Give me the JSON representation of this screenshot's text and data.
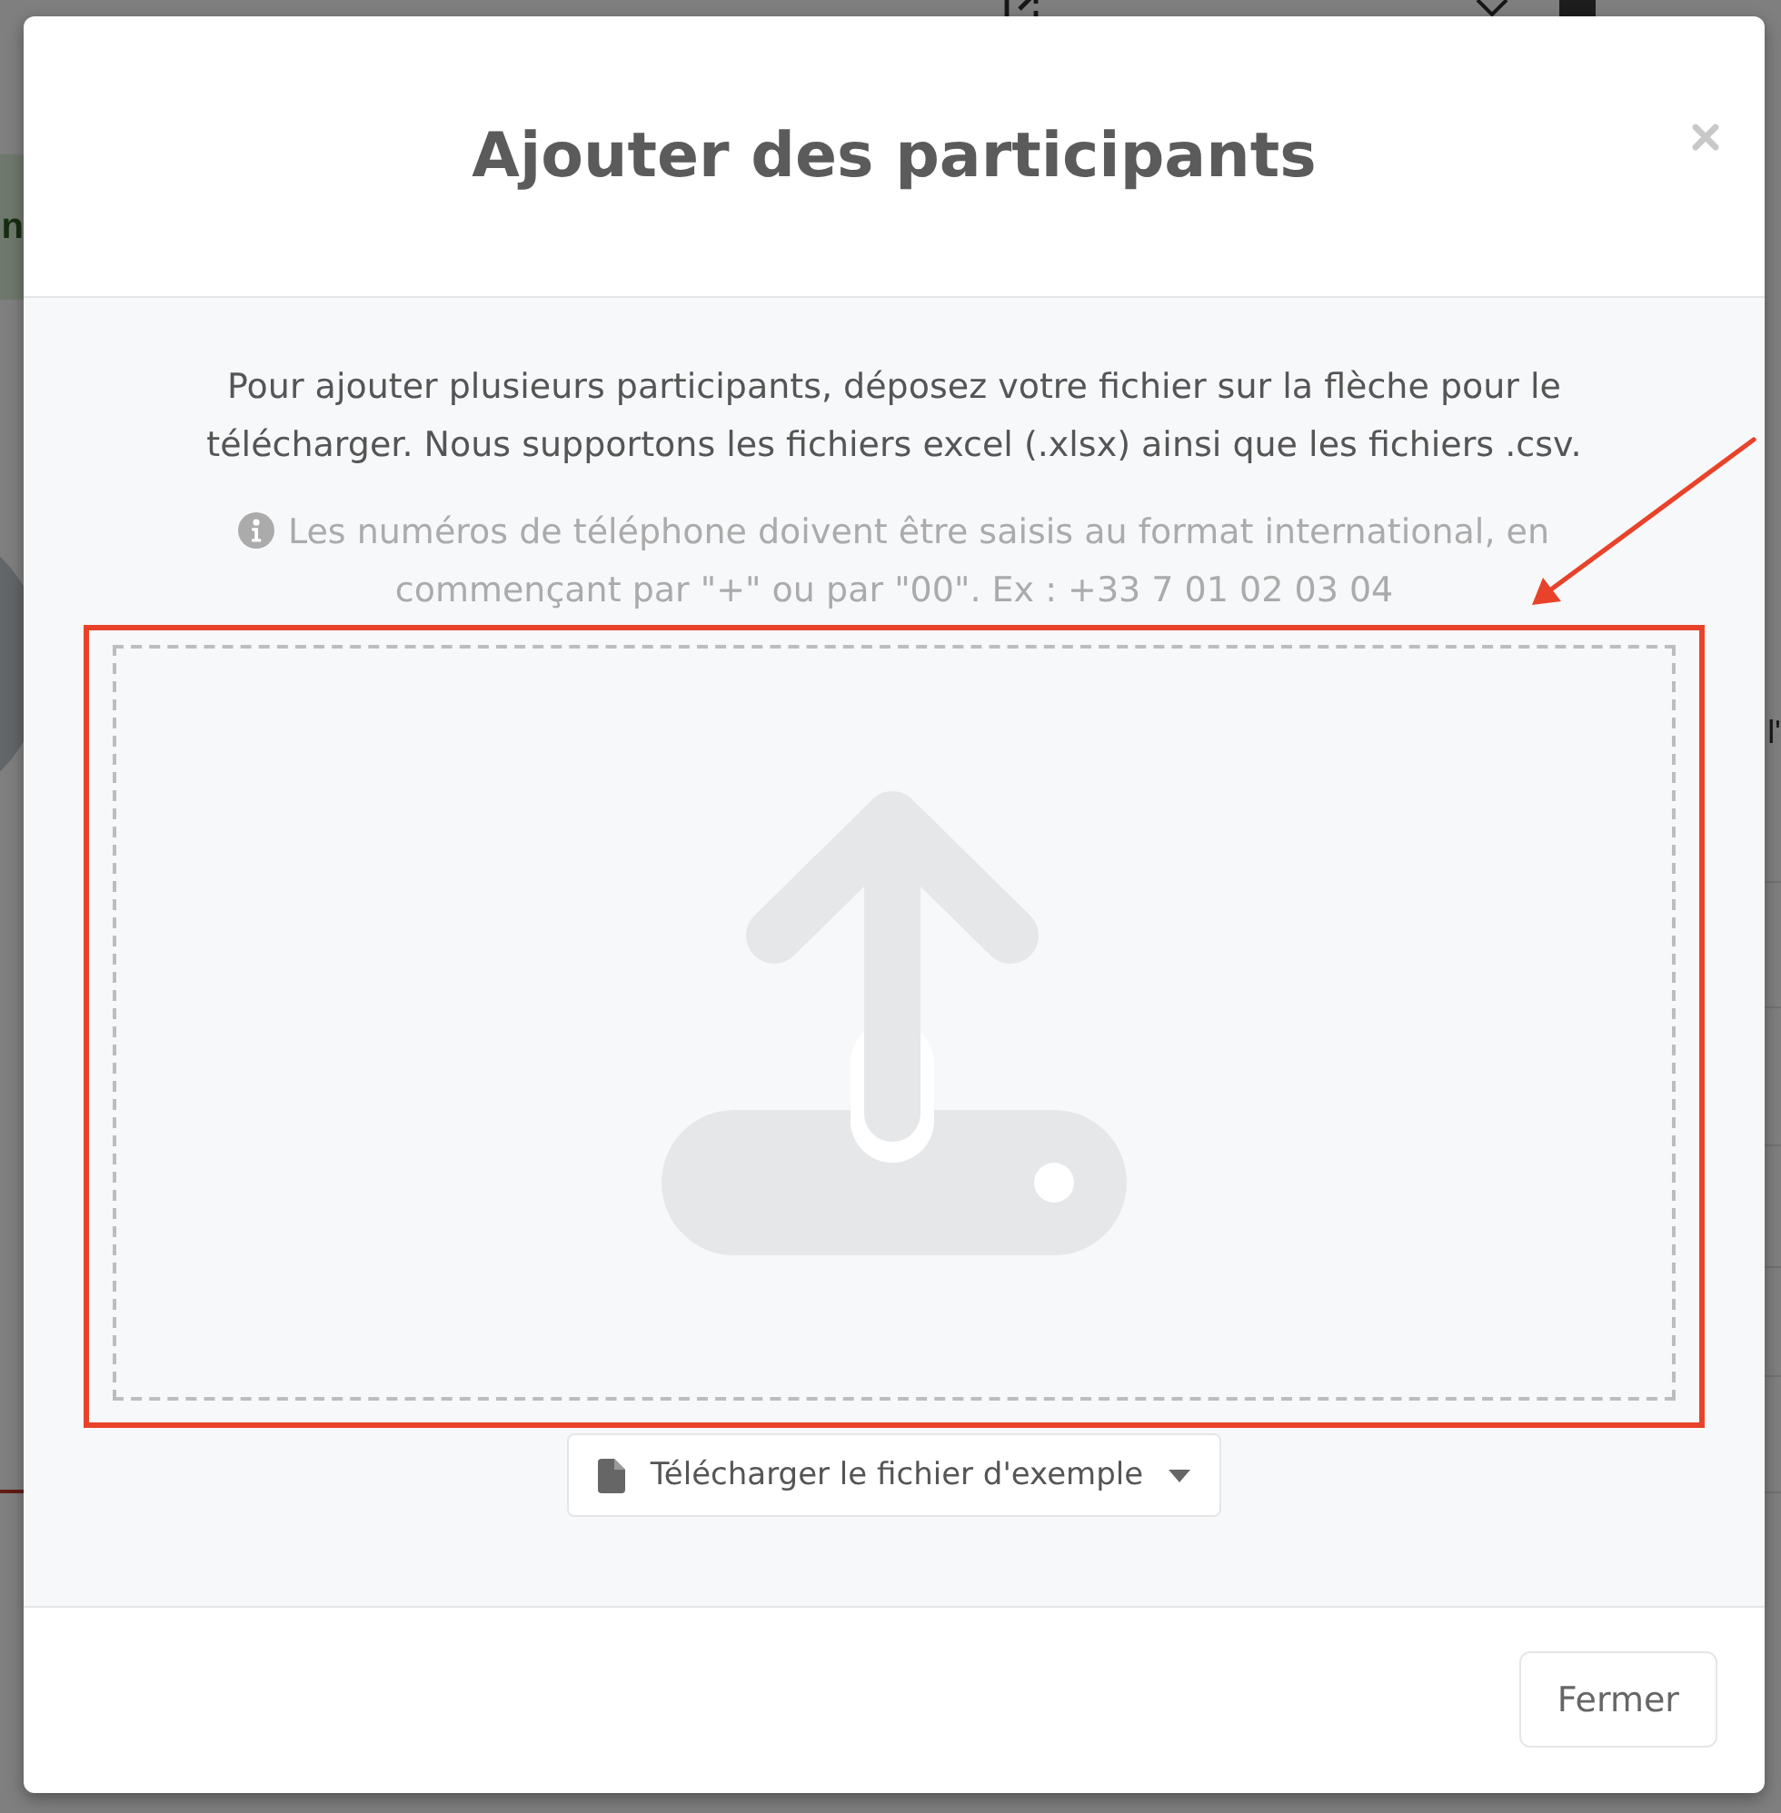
{
  "background_page": {
    "alert_fragment": "n",
    "table_fragments": [
      "l'"
    ]
  },
  "dialog": {
    "title": "Ajouter des participants",
    "description": "Pour ajouter plusieurs participants, déposez votre fichier sur la flèche pour le télécharger. Nous supportons les fichiers excel (.xlsx) ainsi que les fichiers .csv.",
    "info": "Les numéros de téléphone doivent être saisis au format international, en commençant par \"+\" ou par \"00\". Ex : +33 7 01 02 03 04",
    "example_button": "Télécharger le fichier d'exemple",
    "footer_buttons": [
      "Fermer"
    ]
  }
}
